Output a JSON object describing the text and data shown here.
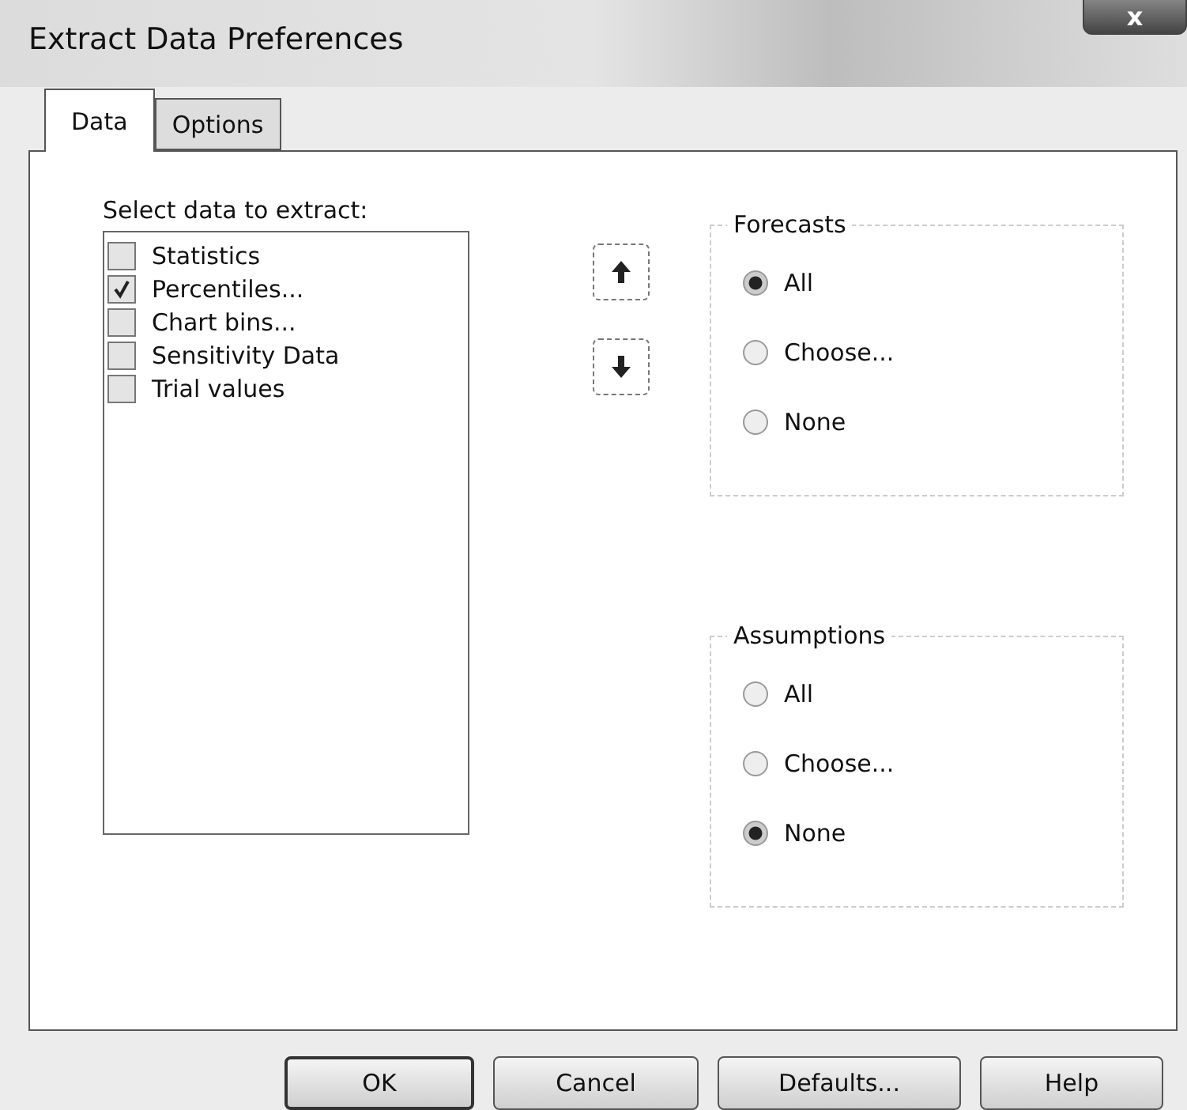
{
  "window": {
    "title": "Extract Data Preferences",
    "close": "x"
  },
  "tabs": [
    {
      "label": "Data",
      "selected": true
    },
    {
      "label": "Options",
      "selected": false
    }
  ],
  "data_list": {
    "label": "Select data to extract:",
    "items": [
      {
        "label": "Statistics",
        "checked": false
      },
      {
        "label": "Percentiles...",
        "checked": true
      },
      {
        "label": "Chart bins...",
        "checked": false
      },
      {
        "label": "Sensitivity Data",
        "checked": false
      },
      {
        "label": "Trial values",
        "checked": false
      }
    ]
  },
  "groups": [
    {
      "title": "Forecasts",
      "options": [
        {
          "label": "All",
          "selected": true
        },
        {
          "label": "Choose...",
          "selected": false
        },
        {
          "label": "None",
          "selected": false
        }
      ]
    },
    {
      "title": "Assumptions",
      "options": [
        {
          "label": "All",
          "selected": false
        },
        {
          "label": "Choose...",
          "selected": false
        },
        {
          "label": "None",
          "selected": true
        }
      ]
    }
  ],
  "buttons": [
    {
      "label": "OK",
      "default": true
    },
    {
      "label": "Cancel",
      "default": false
    },
    {
      "label": "Defaults...",
      "default": false
    },
    {
      "label": "Help",
      "default": false
    }
  ]
}
